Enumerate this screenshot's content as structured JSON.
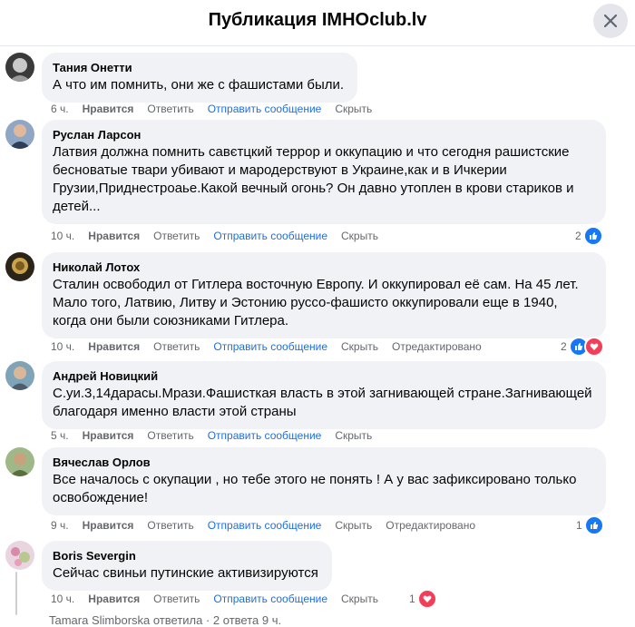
{
  "header": {
    "title": "Публикация IMHOclub.lv"
  },
  "comments": [
    {
      "author": "Тания Онетти",
      "text": "А что им помнить, они же с фашистами были.",
      "time": "6 ч.",
      "like": "Нравится",
      "reply": "Ответить",
      "send": "Отправить сообщение",
      "hide": "Скрыть"
    },
    {
      "author": "Руслан Ларсон",
      "text": "Латвия должна помнить савєтцкий террор и оккупацию и что сегодня рашистские\nбесноватые твари убивают и мародерствуют в Украине,как и в Ичкерии\nГрузии,Приднестроаье.Какой вечный огонь? Он давно утоплен в крови стариков и\nдетей...",
      "time": "10 ч.",
      "like": "Нравится",
      "reply": "Ответить",
      "send": "Отправить сообщение",
      "hide": "Скрыть",
      "reaction_count": "2"
    },
    {
      "author": "Николай Лотох",
      "text": "Сталин освободил от Гитлера восточную Европу. И оккупировал её сам. На 45 лет.\nМало того, Латвию, Литву и Эстонию руссо-фашисто оккупировали еще в 1940,\nкогда они были союзниками Гитлера.",
      "time": "10 ч.",
      "like": "Нравится",
      "reply": "Ответить",
      "send": "Отправить сообщение",
      "hide": "Скрыть",
      "edited": "Отредактировано",
      "reaction_count": "2"
    },
    {
      "author": "Андрей Новицкий",
      "text": "С.уи.3,14дарасы.Мрази.Фашисткая власть в этой загнивающей стране.Загнивающей\nблагодаря именно власти этой страны",
      "time": "5 ч.",
      "like": "Нравится",
      "reply": "Ответить",
      "send": "Отправить сообщение",
      "hide": "Скрыть"
    },
    {
      "author": "Вячеслав Орлов",
      "text": "Все началось с окупации , но тебе этого не понять ! А у вас зафиксировано только\nосвобождение!",
      "time": "9 ч.",
      "like": "Нравится",
      "reply": "Ответить",
      "send": "Отправить сообщение",
      "hide": "Скрыть",
      "edited": "Отредактировано",
      "reaction_count": "1"
    },
    {
      "author": "Boris Severgin",
      "text": "Сейчас свиньи путинские активизируются",
      "time": "10 ч.",
      "like": "Нравится",
      "reply": "Ответить",
      "send": "Отправить сообщение",
      "hide": "Скрыть",
      "reaction_count": "1"
    }
  ],
  "bottom_reply": "Tamara Slimborska ответила · 2 ответа  9 ч.",
  "colors": {
    "like": "#1877f2",
    "love": "#f33e58",
    "link": "#216fdb"
  }
}
